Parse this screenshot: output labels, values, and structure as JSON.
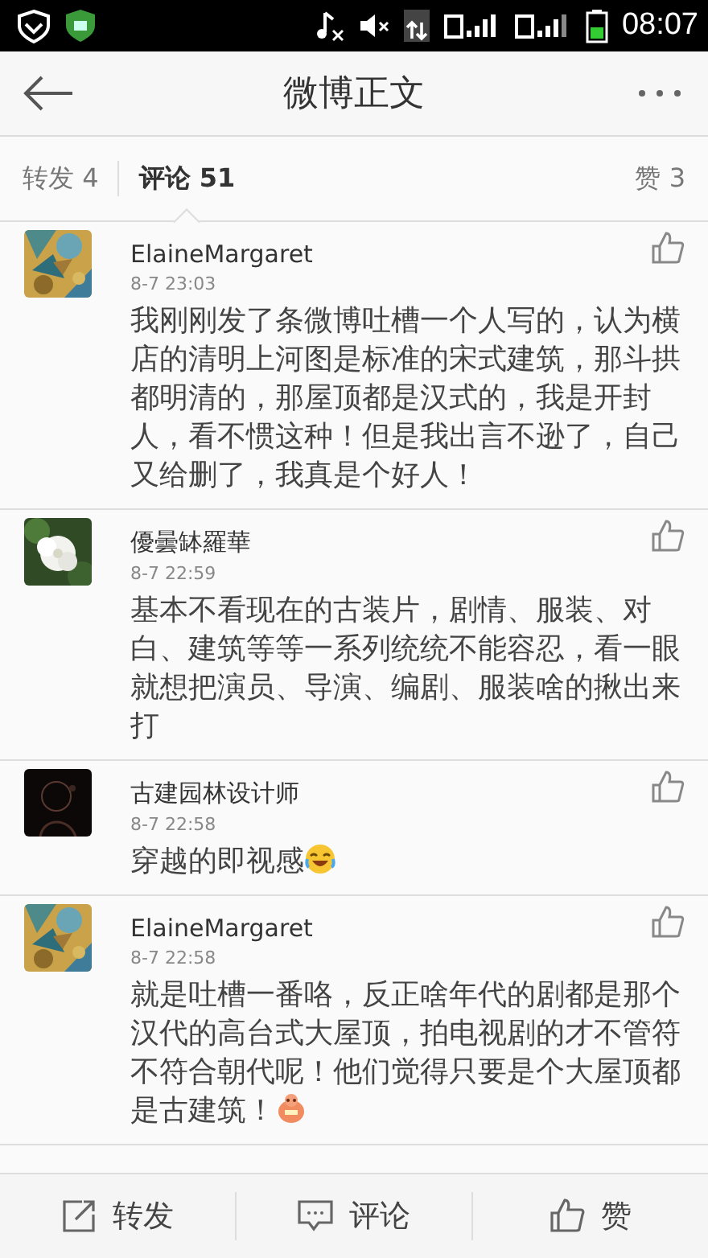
{
  "status_bar": {
    "time": "08:07"
  },
  "header": {
    "title": "微博正文"
  },
  "tabs": [
    {
      "label": "转发 4",
      "selected": false
    },
    {
      "label": "评论 51",
      "selected": true
    },
    {
      "label": "赞 3",
      "selected": false
    }
  ],
  "comments": [
    {
      "name": "ElaineMargaret",
      "time": "8-7 23:03",
      "kind": "plain",
      "text": "我刚刚发了条微博吐槽一个人写的，认为横店的清明上河图是标准的宋式建筑，那斗拱都明清的，那屋顶都是汉式的，我是开封人，看不惯这种！但是我出言不逊了，自己又给删了，我真是个好人！"
    },
    {
      "name": "優曇缽羅華",
      "time": "8-7 22:59",
      "kind": "plain",
      "text": "基本不看现在的古装片，剧情、服装、对白、建筑等等一系列统统不能容忍，看一眼就想把演员、导演、编剧、服装啥的揪出来打"
    },
    {
      "name": "古建园林设计师",
      "time": "8-7 22:58",
      "kind": "laughing",
      "text": "穿越的即视感"
    },
    {
      "name": "ElaineMargaret",
      "time": "8-7 22:58",
      "kind": "pig",
      "text": "就是吐槽一番咯，反正啥年代的剧都是那个汉代的高台式大屋顶，拍电视剧的才不管符不符合朝代呢！他们觉得只要是个大屋顶都是古建筑！"
    }
  ],
  "actions": [
    {
      "kind": "share",
      "label": "转发"
    },
    {
      "kind": "comment",
      "label": "评论"
    },
    {
      "kind": "like",
      "label": "赞"
    }
  ]
}
